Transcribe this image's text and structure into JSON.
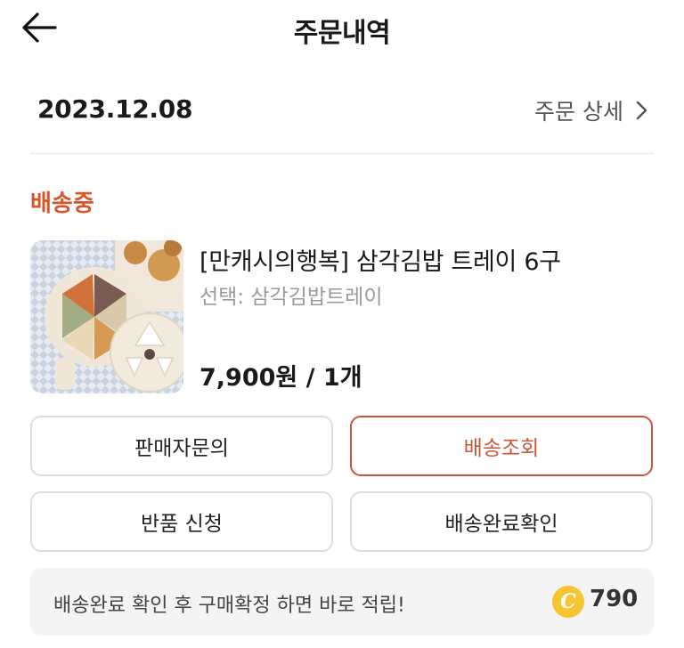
{
  "header": {
    "title": "주문내역",
    "back_icon": "arrow-left-icon"
  },
  "order": {
    "date": "2023.12.08",
    "detail_label": "주문 상세",
    "detail_icon": "chevron-right-icon",
    "status": "배송중"
  },
  "product": {
    "name": "[만캐시의행복] 삼각김밥 트레이 6구",
    "option": "선택: 삼각김밥트레이",
    "price": "7,900원 / 1개"
  },
  "actions": {
    "seller_inquiry": "판매자문의",
    "track_shipping": "배송조회",
    "return_request": "반품 신청",
    "confirm_delivery": "배송완료확인"
  },
  "reward": {
    "message": "배송완료 확인 후 구매확정 하면 바로 적립!",
    "coin_symbol": "C",
    "points": "790"
  },
  "colors": {
    "accent": "#d8572a",
    "coin": "#f7c531"
  }
}
